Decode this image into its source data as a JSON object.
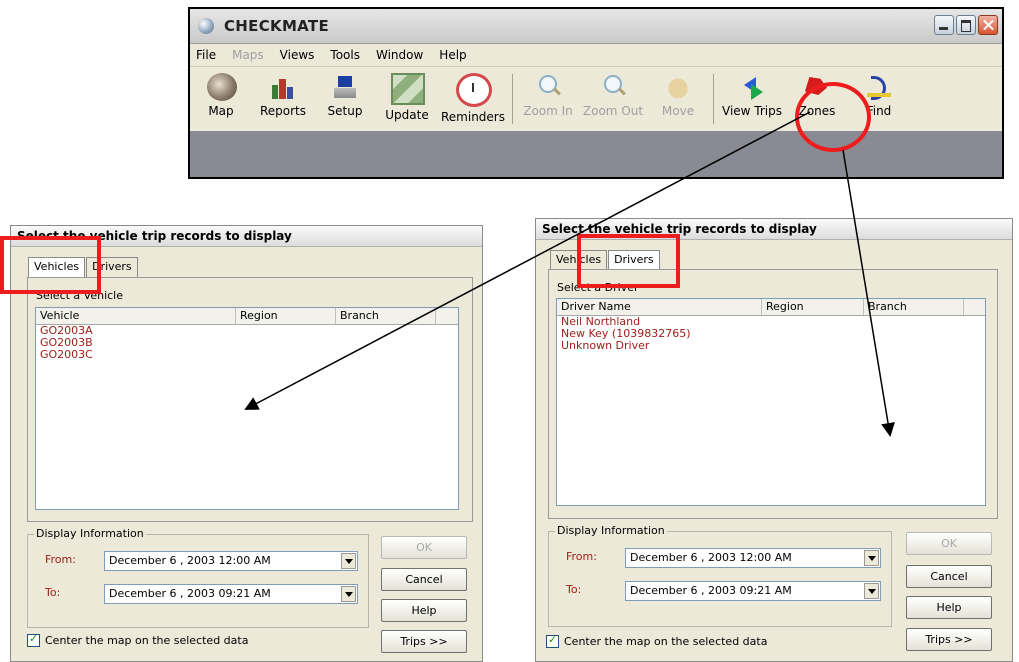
{
  "app": {
    "title": "CHECKMATE",
    "menu": [
      {
        "label": "File",
        "disabled": false
      },
      {
        "label": "Maps",
        "disabled": true
      },
      {
        "label": "Views",
        "disabled": false
      },
      {
        "label": "Tools",
        "disabled": false
      },
      {
        "label": "Window",
        "disabled": false
      },
      {
        "label": "Help",
        "disabled": false
      }
    ],
    "toolbar": {
      "map": "Map",
      "reports": "Reports",
      "setup": "Setup",
      "update": "Update",
      "reminders": "Reminders",
      "zoom_in": "Zoom In",
      "zoom_out": "Zoom Out",
      "move": "Move",
      "view_trips": "View Trips",
      "zones": "Zones",
      "find": "Find"
    }
  },
  "dialog_vehicles": {
    "title": "Select the vehicle trip records to display",
    "tabs": [
      "Vehicles",
      "Drivers"
    ],
    "active_tab": "Vehicles",
    "group_label": "Select a Vehicle",
    "columns": [
      "Vehicle",
      "Region",
      "Branch"
    ],
    "rows": [
      "GO2003A",
      "GO2003B",
      "GO2003C"
    ],
    "display_info": "Display Information",
    "from_label": "From:",
    "from_value": "December  6 , 2003 12:00 AM",
    "to_label": "To:",
    "to_value": "December  6 , 2003 09:21 AM",
    "ok": "OK",
    "cancel": "Cancel",
    "help": "Help",
    "trips": "Trips >>",
    "center_check": "Center the map on the selected data"
  },
  "dialog_drivers": {
    "title": "Select the vehicle trip records to display",
    "tabs": [
      "Vehicles",
      "Drivers"
    ],
    "active_tab": "Drivers",
    "group_label": "Select a Driver",
    "columns": [
      "Driver Name",
      "Region",
      "Branch"
    ],
    "rows": [
      "Neil Northland",
      "New Key (1039832765)",
      "Unknown Driver"
    ],
    "display_info": "Display Information",
    "from_label": "From:",
    "from_value": "December  6 , 2003 12:00 AM",
    "to_label": "To:",
    "to_value": "December  6 , 2003 09:21 AM",
    "ok": "OK",
    "cancel": "Cancel",
    "help": "Help",
    "trips": "Trips >>",
    "center_check": "Center the map on the selected data"
  },
  "colors": {
    "annotation": "#ee1c1c",
    "list_text": "#a0201a",
    "window_bg": "#ece9d8"
  }
}
